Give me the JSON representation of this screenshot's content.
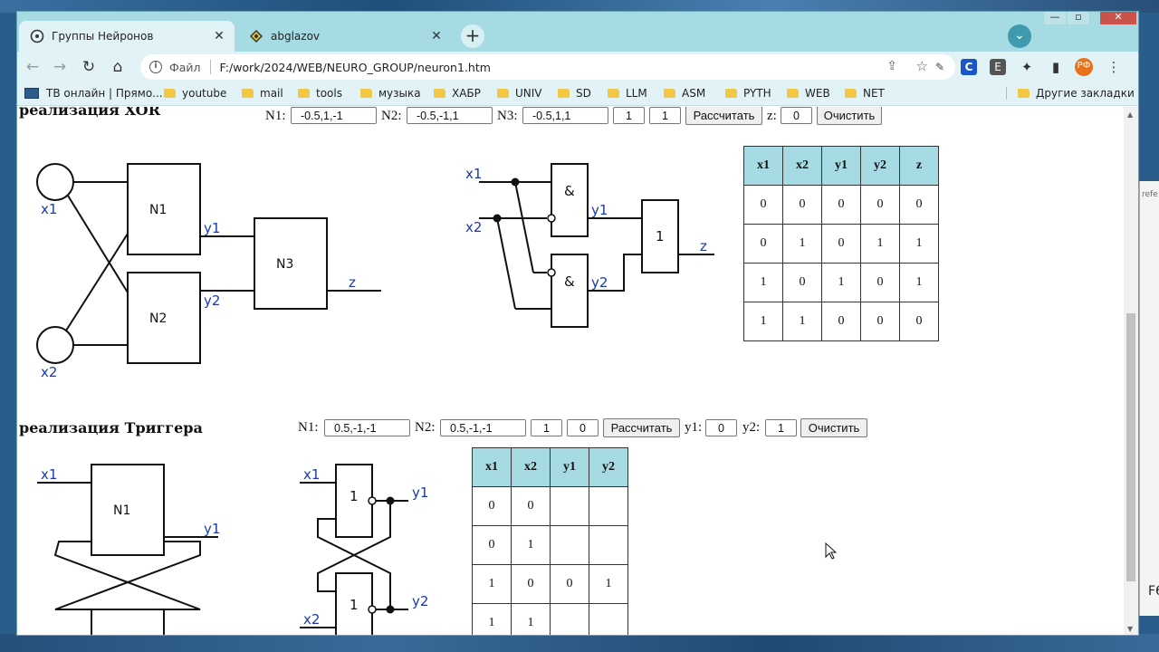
{
  "browser": {
    "tabs": [
      {
        "title": "Группы Нейронов",
        "active": true
      },
      {
        "title": "abglazov",
        "active": false
      }
    ],
    "address": {
      "scheme_label": "Файл",
      "url": "F:/work/2024/WEB/NEURO_GROUP/neuron1.htm"
    },
    "extensions": [
      "С",
      "E",
      "РФ"
    ],
    "bookmarks": [
      "ТВ онлайн | Прямо...",
      "youtube",
      "mail",
      "tools",
      "музыка",
      "ХАБР",
      "UNIV",
      "SD",
      "LLM",
      "ASM",
      "PYTH",
      "WEB",
      "NET"
    ],
    "other_bookmarks": "Другие закладки",
    "colors": {
      "tabbar": "#a6dbe3",
      "toolbar": "#e1f3f6",
      "table_header": "#a6dbe3",
      "profile": "#e8711c"
    }
  },
  "xor": {
    "title": "реализация XOR",
    "n1_label": "N1:",
    "n1_value": "-0.5,1,-1",
    "n2_label": "N2:",
    "n2_value": "-0.5,-1,1",
    "n3_label": "N3:",
    "n3_value": "-0.5,1,1",
    "in1": "1",
    "in2": "1",
    "calc_button": "Рассчитать",
    "z_label": "z:",
    "z_value": "0",
    "clear_button": "Очистить",
    "net_labels": {
      "x1": "x1",
      "x2": "x2",
      "y1": "y1",
      "y2": "y2",
      "z": "z",
      "n1": "N1",
      "n2": "N2",
      "n3": "N3"
    },
    "logic_labels": {
      "x1": "x1",
      "x2": "x2",
      "y1": "y1",
      "y2": "y2",
      "z": "z",
      "and": "&",
      "or": "1"
    },
    "table": {
      "headers": [
        "x1",
        "x2",
        "y1",
        "y2",
        "z"
      ],
      "rows": [
        [
          "0",
          "0",
          "0",
          "0",
          "0"
        ],
        [
          "0",
          "1",
          "0",
          "1",
          "1"
        ],
        [
          "1",
          "0",
          "1",
          "0",
          "1"
        ],
        [
          "1",
          "1",
          "0",
          "0",
          "0"
        ]
      ]
    }
  },
  "trigger": {
    "title": "реализация Триггера",
    "n1_label": "N1:",
    "n1_value": "0.5,-1,-1",
    "n2_label": "N2:",
    "n2_value": "0.5,-1,-1",
    "in1": "1",
    "in2": "0",
    "calc_button": "Рассчитать",
    "y1_label": "y1:",
    "y1_value": "0",
    "y2_label": "y2:",
    "y2_value": "1",
    "clear_button": "Очистить",
    "net_labels": {
      "x1": "x1",
      "y1": "y1",
      "n1": "N1"
    },
    "logic_labels": {
      "x1": "x1",
      "x2": "x2",
      "y1": "y1",
      "y2": "y2",
      "nor": "1"
    },
    "table": {
      "headers": [
        "x1",
        "x2",
        "y1",
        "y2"
      ],
      "rows": [
        [
          "0",
          "0",
          "",
          ""
        ],
        [
          "0",
          "1",
          "",
          ""
        ],
        [
          "1",
          "0",
          "0",
          "1"
        ],
        [
          "1",
          "1",
          "",
          ""
        ]
      ]
    }
  }
}
